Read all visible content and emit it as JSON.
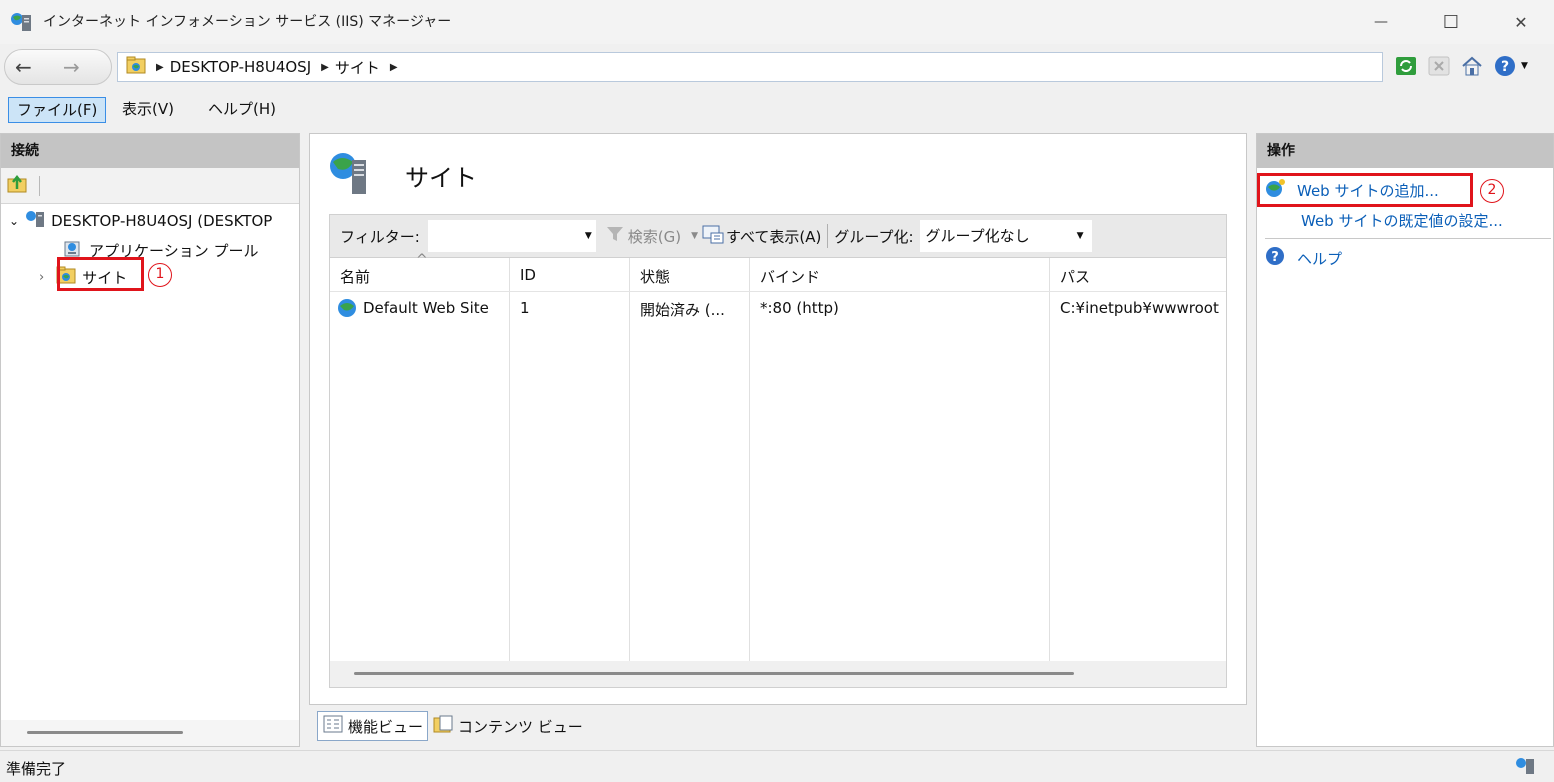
{
  "window": {
    "title": "インターネット インフォメーション サービス (IIS) マネージャー",
    "minimize_glyph": "—",
    "maximize_glyph": "☐",
    "close_glyph": "✕"
  },
  "address": {
    "crumbs": [
      "DESKTOP-H8U4OSJ",
      "サイト"
    ],
    "back_glyph": "←",
    "forward_glyph": "→",
    "toolbar_icons": [
      "refresh-icon",
      "stop-icon",
      "home-icon",
      "help-icon"
    ]
  },
  "menu": {
    "file": "ファイル(F)",
    "view": "表示(V)",
    "help": "ヘルプ(H)"
  },
  "connections": {
    "header": "接続",
    "tree": {
      "server": "DESKTOP-H8U4OSJ (DESKTOP",
      "app_pools": "アプリケーション プール",
      "sites": "サイト"
    }
  },
  "center": {
    "title": "サイト",
    "filter_label": "フィルター:",
    "filter_value": "",
    "search_label": "検索(G)",
    "show_all_label": "すべて表示(A)",
    "group_label": "グループ化:",
    "group_value": "グループ化なし",
    "columns": [
      "名前",
      "ID",
      "状態",
      "バインド",
      "パス"
    ],
    "rows": [
      {
        "name": "Default Web Site",
        "id": "1",
        "status": "開始済み (...",
        "binding": "*:80 (http)",
        "path": "C:¥inetpub¥wwwroot"
      }
    ],
    "tabs": {
      "features": "機能ビュー",
      "content": "コンテンツ ビュー"
    }
  },
  "actions": {
    "header": "操作",
    "add_site": "Web サイトの追加...",
    "set_defaults": "Web サイトの既定値の設定...",
    "help": "ヘルプ"
  },
  "annotations": {
    "callout_1": "1",
    "callout_2": "2",
    "color": "#e0141b"
  },
  "status": {
    "text": "準備完了"
  },
  "colors": {
    "link": "#0b5fb8",
    "panel_header": "#c4c4c4",
    "selection_border": "#3a8ee6"
  }
}
